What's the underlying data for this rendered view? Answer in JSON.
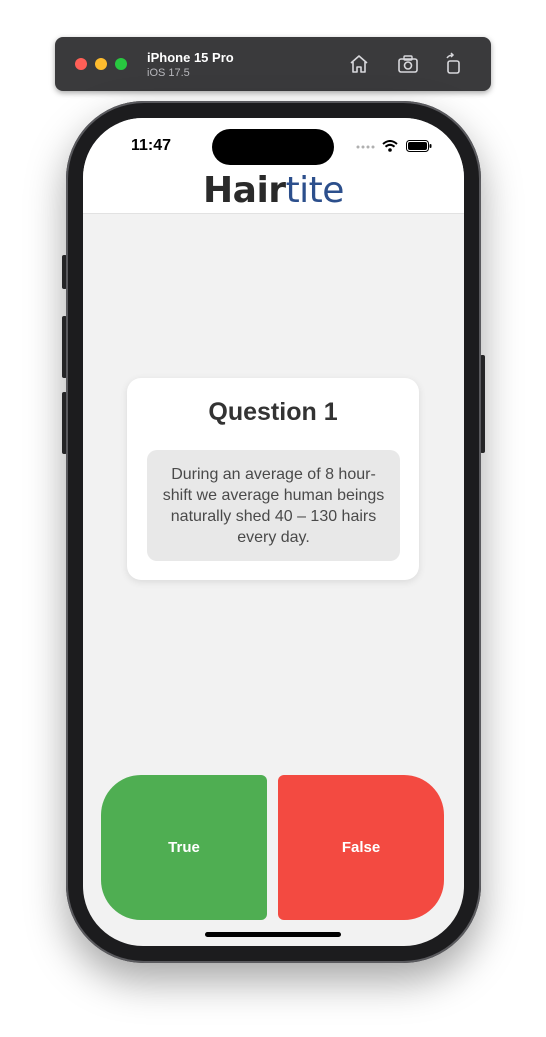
{
  "simulator": {
    "device_name": "iPhone 15 Pro",
    "os_version": "iOS 17.5",
    "icons": [
      "home-icon",
      "screenshot-icon",
      "rotate-icon"
    ]
  },
  "status_bar": {
    "time": "11:47",
    "icons": [
      "signal-dots-icon",
      "wifi-icon",
      "battery-icon"
    ]
  },
  "header": {
    "logo_part1": "Hair",
    "logo_part2": "tite"
  },
  "question": {
    "title": "Question 1",
    "text": "During an average of 8 hour-shift we average human beings naturally shed 40 – 130 hairs every day."
  },
  "answers": {
    "true_label": "True",
    "false_label": "False"
  },
  "colors": {
    "true_button": "#4fae52",
    "false_button": "#f34a41",
    "logo_dark": "#2a2a2a",
    "logo_blue": "#2c4f8c"
  }
}
